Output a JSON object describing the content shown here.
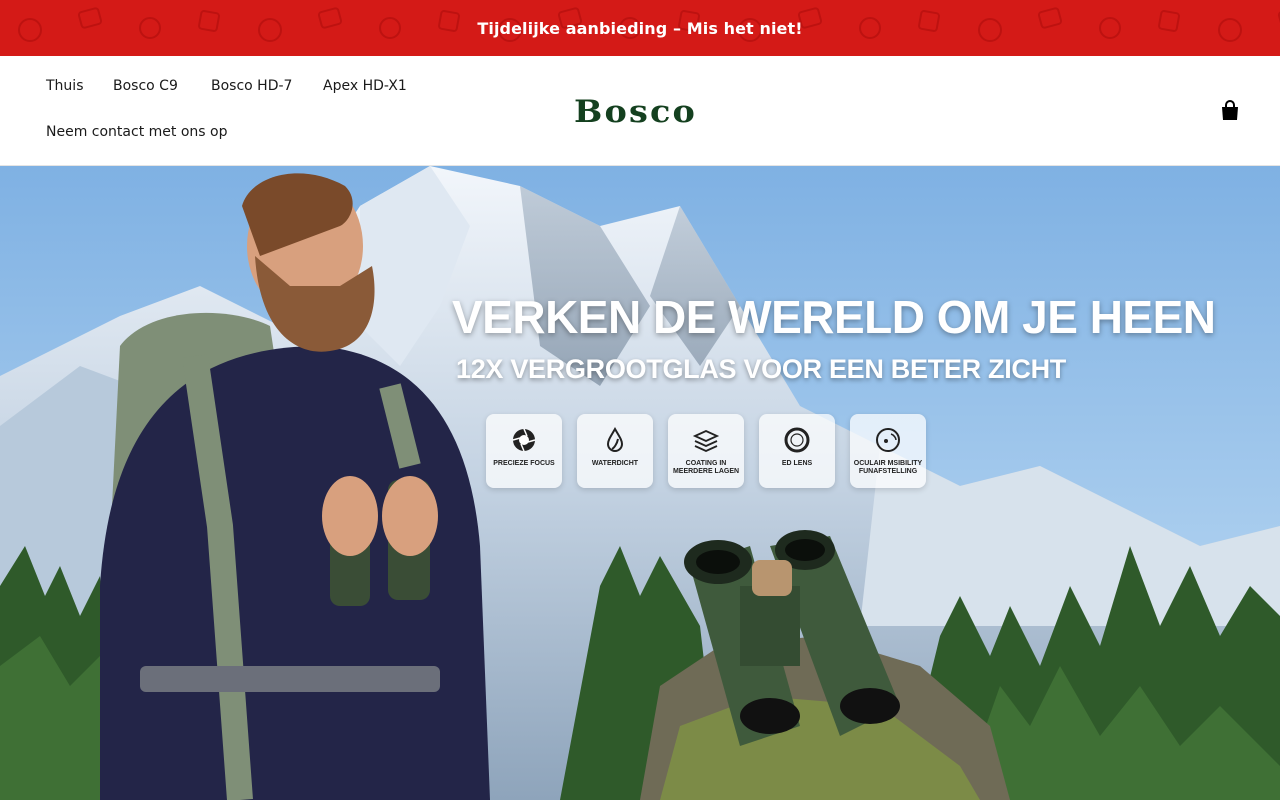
{
  "announcement": {
    "text": "Tijdelijke aanbieding – Mis het niet!"
  },
  "nav": {
    "items": [
      {
        "label": "Thuis"
      },
      {
        "label": "Bosco C9"
      },
      {
        "label": "Bosco HD-7"
      },
      {
        "label": "Apex HD-X1"
      },
      {
        "label": "Neem contact met ons op"
      }
    ]
  },
  "logo": {
    "text": "Bosco"
  },
  "cart": {
    "icon": "shopping-bag-icon"
  },
  "hero": {
    "headline": "VERKEN DE WERELD OM JE HEEN",
    "subline": "12X VERGROOTGLAS VOOR EEN BETER ZICHT",
    "features": [
      {
        "label": "PRECIEZE FOCUS",
        "icon": "aperture-icon"
      },
      {
        "label": "WATERDICHT",
        "icon": "water-drop-icon"
      },
      {
        "label": "COATING IN MEERDERE LAGEN",
        "icon": "layers-icon"
      },
      {
        "label": "ED LENS",
        "icon": "lens-icon"
      },
      {
        "label": "OCULAIR MSIBILITY FUNAFSTELLING",
        "icon": "eyepiece-icon"
      }
    ]
  },
  "colors": {
    "announcement_bg": "#d41a17",
    "logo": "#14401f"
  }
}
